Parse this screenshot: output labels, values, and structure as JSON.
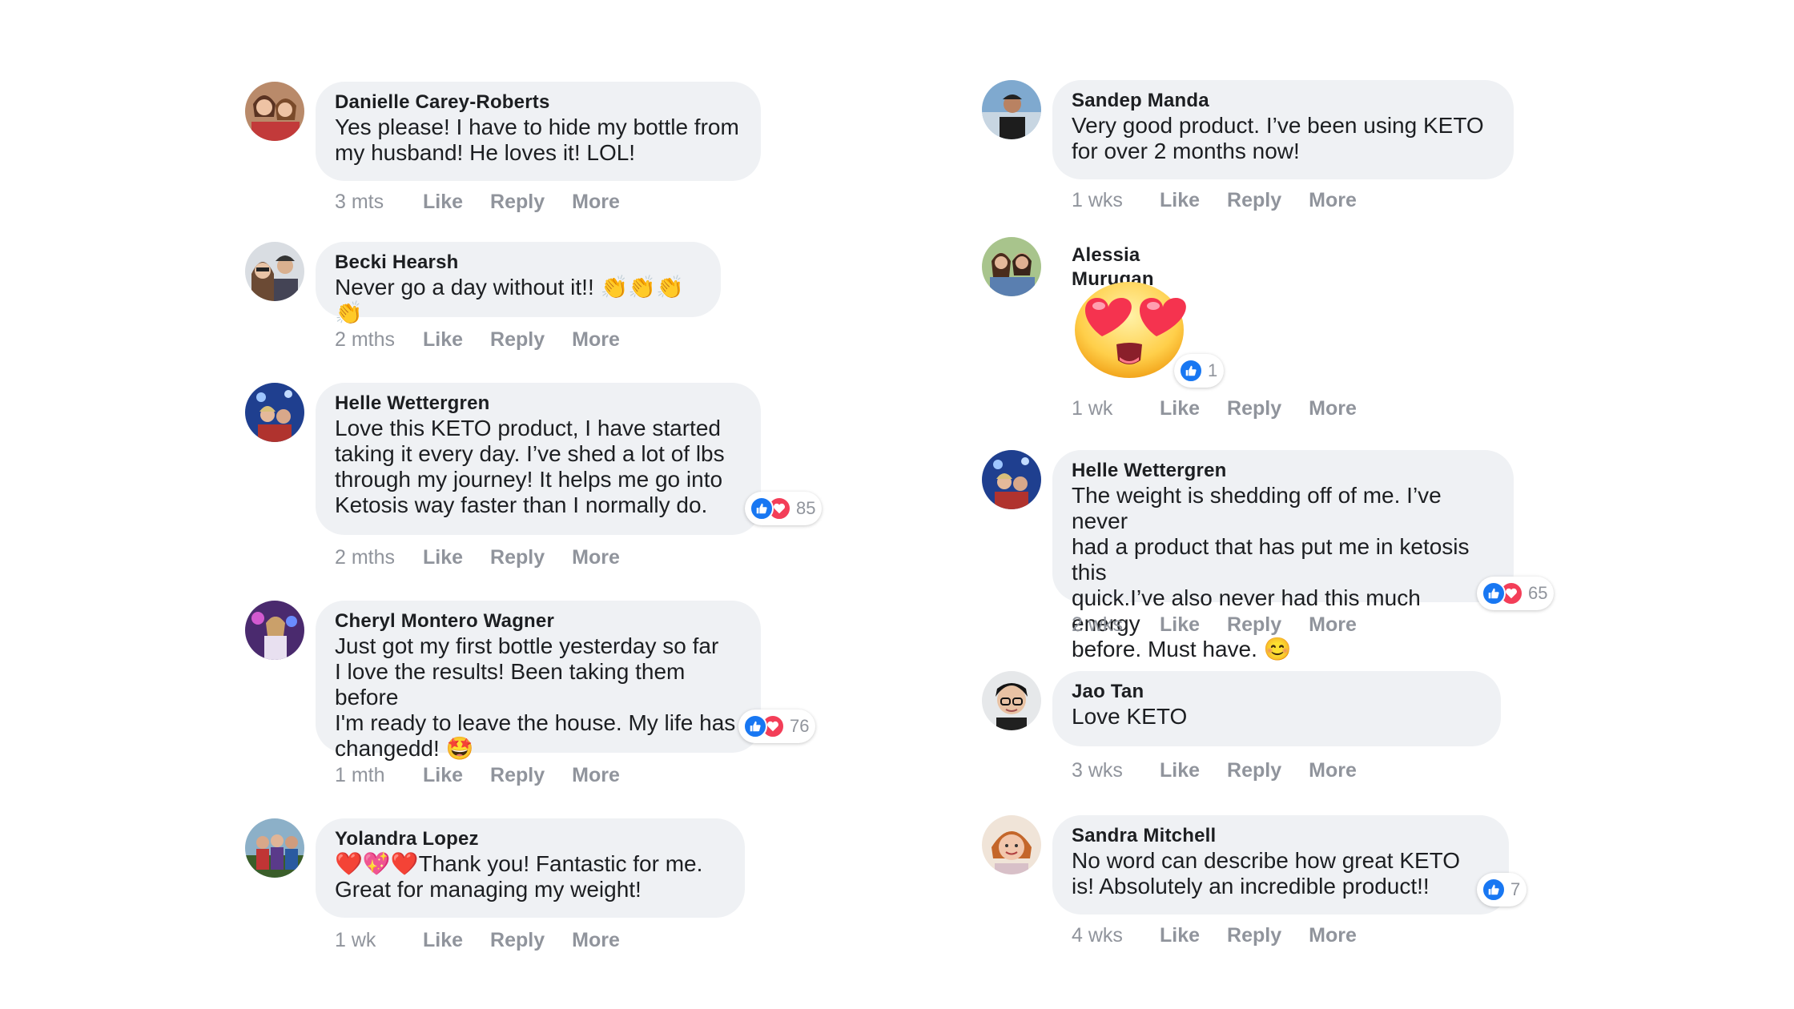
{
  "actions": {
    "like": "Like",
    "reply": "Reply",
    "more": "More"
  },
  "colors": {
    "bubble": "#eff1f4",
    "like_blue": "#1877f2",
    "love_red": "#f33e58",
    "muted": "#90949c"
  },
  "left_column": [
    {
      "name": "Danielle Carey-Roberts",
      "lines": [
        "Yes please! I have to hide my bottle from",
        "my husband! He loves it! LOL!"
      ],
      "time": "3 mts"
    },
    {
      "name": "Becki Hearsh",
      "lines": [
        "Never go a day without it!! 👏👏👏👏"
      ],
      "time": "2 mths"
    },
    {
      "name": "Helle Wettergren",
      "lines": [
        "Love this KETO product, I have started",
        "taking it every day. I’ve shed a lot of lbs",
        "through my journey! It helps me go into",
        "Ketosis way faster than I normally do."
      ],
      "time": "2 mths",
      "reactions": "85"
    },
    {
      "name": "Cheryl Montero Wagner",
      "lines": [
        "Just got my first bottle yesterday so far",
        "I love the results! Been taking them before",
        "I'm ready to leave the house. My life has",
        "changedd! 🤩"
      ],
      "time": "1 mth",
      "reactions": "76"
    },
    {
      "name": "Yolandra Lopez",
      "lines": [
        "❤️💖❤️Thank you! Fantastic for me.",
        "Great for managing my weight!"
      ],
      "time": "1 wk"
    }
  ],
  "right_column": [
    {
      "name": "Sandep Manda",
      "lines": [
        "Very good product. I’ve been using KETO",
        " for over 2 months now!"
      ],
      "time": "1 wks"
    },
    {
      "name": "Alessia Murugan",
      "sticker": "heart-eyes-emoji",
      "time": "1 wk",
      "reactions": "1"
    },
    {
      "name": "Helle Wettergren",
      "lines": [
        "The weight is shedding off of me. I’ve never",
        "had a product that has put me in ketosis this",
        "quick.I’ve also never had this much energy",
        "before. Must have. 😊"
      ],
      "time": "2 wks",
      "reactions": "65"
    },
    {
      "name": "Jao Tan",
      "lines": [
        "Love KETO"
      ],
      "time": "3 wks"
    },
    {
      "name": "Sandra Mitchell",
      "lines": [
        "No word can describe how great KETO",
        "is! Absolutely an incredible product!!"
      ],
      "time": "4 wks",
      "reactions": "7"
    }
  ]
}
